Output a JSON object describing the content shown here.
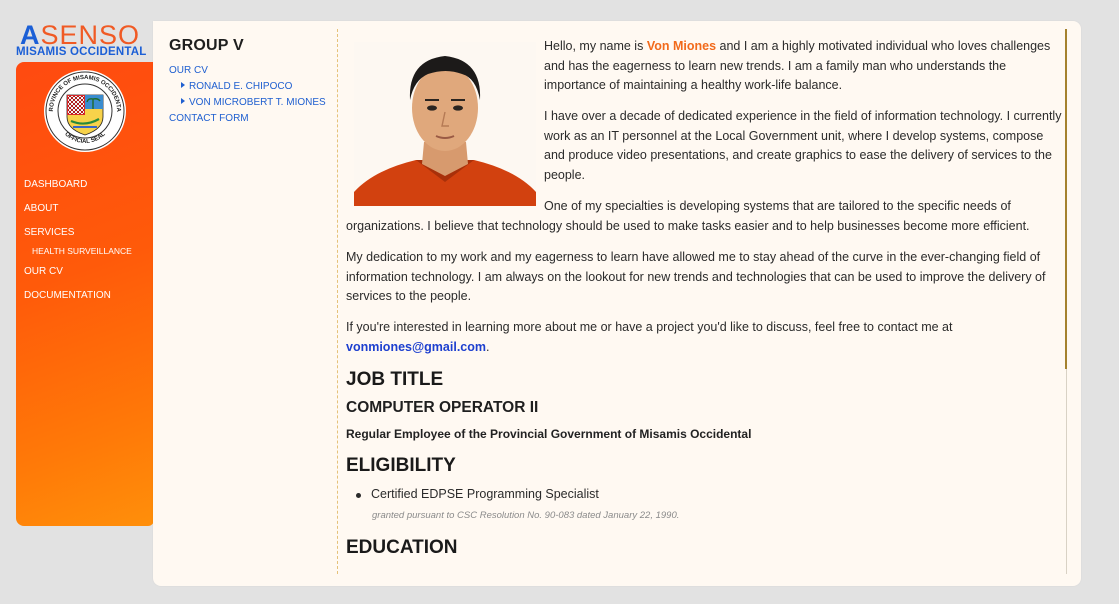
{
  "brand": {
    "accent_letter": "A",
    "word_rest": "SENSO",
    "subtitle": "MISAMIS OCCIDENTAL",
    "seal_text_top": "PROVINCE OF MISAMIS OCCIDENTAL",
    "seal_text_bottom": "OFFICIAL SEAL",
    "colors": {
      "orange": "#f05a24",
      "blue": "#1b5fd6"
    }
  },
  "sidebar": {
    "items": [
      {
        "label": "DASHBOARD"
      },
      {
        "label": "ABOUT"
      },
      {
        "label": "SERVICES"
      },
      {
        "label": "HEALTH SURVEILLANCE",
        "sub": true
      },
      {
        "label": "OUR CV"
      },
      {
        "label": "DOCUMENTATION"
      }
    ]
  },
  "toc": {
    "title": "GROUP V",
    "links": [
      {
        "label": "OUR CV"
      },
      {
        "label": "RONALD E. CHIPOCO"
      },
      {
        "label": "VON MICROBERT T. MIONES"
      },
      {
        "label": "CONTACT FORM"
      }
    ]
  },
  "profile": {
    "intro_before": "Hello, my name is ",
    "name": "Von Miones",
    "intro_after": " and I am a highly motivated individual who loves challenges and has the eagerness to learn new trends. I am a family man who understands the importance of maintaining a healthy work-life balance.",
    "experience": "I have over a decade of dedicated experience in the field of information technology. I currently work as an IT personnel at the Local Government unit, where I develop systems, compose and produce video presentations, and create graphics to ease the delivery of services to the people.",
    "specialties": "One of my specialties is developing systems that are tailored to the specific needs of organizations. I believe that technology should be used to make tasks easier and to help businesses become more efficient.",
    "dedication": "My dedication to my work and my eagerness to learn have allowed me to stay ahead of the curve in the ever-changing field of information technology. I am always on the lookout for new trends and technologies that can be used to improve the delivery of services to the people.",
    "contact_before": "If you're interested in learning more about me or have a project you'd like to discuss, feel free to contact me at ",
    "email": "vonmiones@gmail.com",
    "contact_after": "."
  },
  "job": {
    "heading": "JOB TITLE",
    "title": "COMPUTER OPERATOR II",
    "description": "Regular Employee of the Provincial Government of Misamis Occidental"
  },
  "eligibility": {
    "heading": "ELIGIBILITY",
    "items": [
      {
        "label": "Certified EDPSE Programming Specialist"
      }
    ],
    "note": "granted pursuant to CSC Resolution No. 90-083 dated January 22, 1990."
  },
  "education": {
    "heading": "EDUCATION"
  }
}
